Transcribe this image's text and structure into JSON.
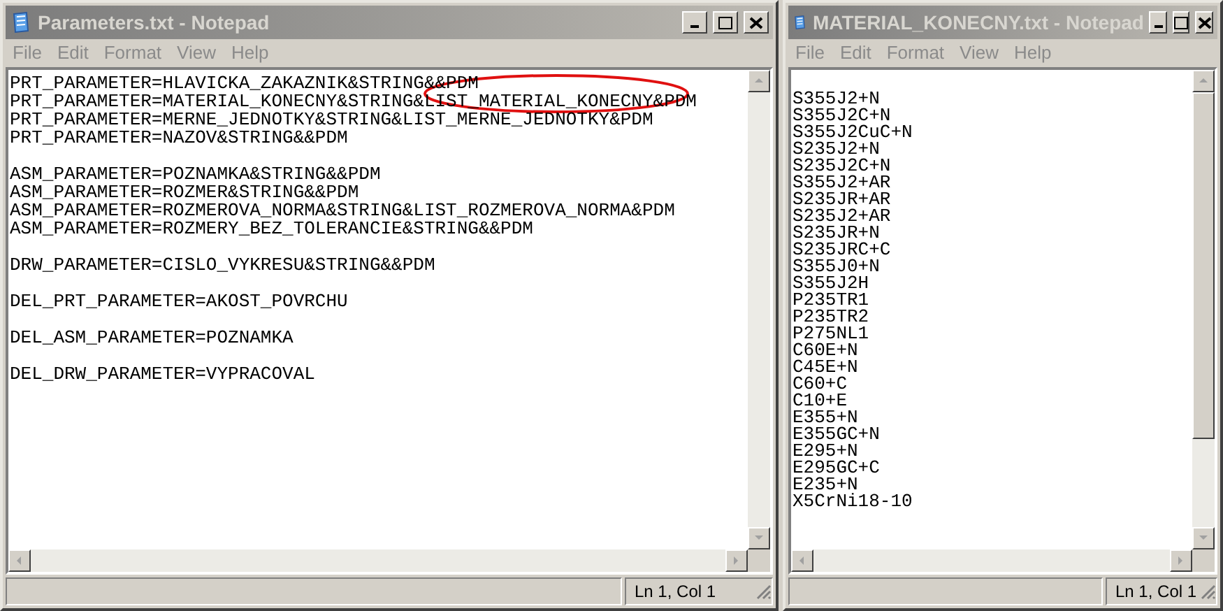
{
  "windows": [
    {
      "title": "Parameters.txt - Notepad",
      "menu": [
        "File",
        "Edit",
        "Format",
        "View",
        "Help"
      ],
      "annotation": {
        "kind": "ellipse"
      },
      "blocks": [
        [
          "PRT_PARAMETER=HLAVICKA_ZAKAZNIK&STRING&&PDM",
          "PRT_PARAMETER=MATERIAL_KONECNY&STRING&LIST_MATERIAL_KONECNY&PDM",
          "PRT_PARAMETER=MERNE_JEDNOTKY&STRING&LIST_MERNE_JEDNOTKY&PDM",
          "PRT_PARAMETER=NAZOV&STRING&&PDM"
        ],
        [
          "ASM_PARAMETER=POZNAMKA&STRING&&PDM",
          "ASM_PARAMETER=ROZMER&STRING&&PDM",
          "ASM_PARAMETER=ROZMEROVA_NORMA&STRING&LIST_ROZMEROVA_NORMA&PDM",
          "ASM_PARAMETER=ROZMERY_BEZ_TOLERANCIE&STRING&&PDM"
        ],
        [
          "DRW_PARAMETER=CISLO_VYKRESU&STRING&&PDM"
        ],
        [
          "DEL_PRT_PARAMETER=AKOST_POVRCHU"
        ],
        [
          "DEL_ASM_PARAMETER=POZNAMKA"
        ],
        [
          "DEL_DRW_PARAMETER=VYPRACOVAL"
        ]
      ],
      "status": "Ln 1, Col 1"
    },
    {
      "title": "MATERIAL_KONECNY.txt - Notepad",
      "menu": [
        "File",
        "Edit",
        "Format",
        "View",
        "Help"
      ],
      "blocks": [
        [
          "S355J2+N",
          "S355J2C+N",
          "S355J2CuC+N",
          "S235J2+N",
          "S235J2C+N",
          "S355J2+AR",
          "S235JR+AR",
          "S235J2+AR",
          "S235JR+N",
          "S235JRC+C",
          "S355J0+N",
          "S355J2H",
          "P235TR1",
          "P235TR2",
          "P275NL1",
          "C60E+N",
          "C45E+N",
          "C60+C",
          "C10+E",
          "E355+N",
          "E355GC+N",
          "E295+N",
          "E295GC+C",
          "E235+N",
          "X5CrNi18-10"
        ]
      ],
      "status": "Ln 1, Col 1"
    }
  ]
}
